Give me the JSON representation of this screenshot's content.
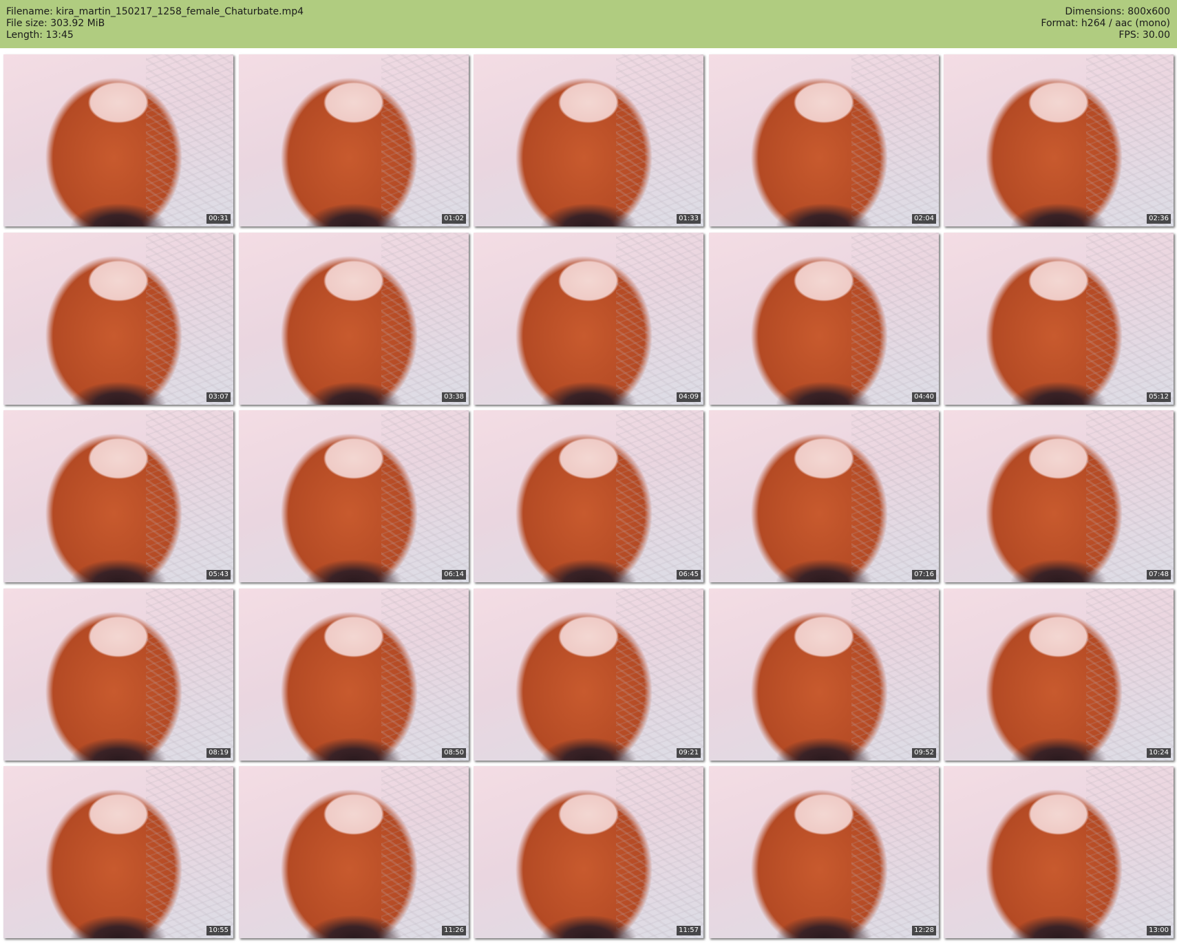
{
  "header": {
    "filename": "Filename: kira_martin_150217_1258_female_Chaturbate.mp4",
    "filesize": "File size: 303.92 MiB",
    "length": "Length: 13:45",
    "dimensions": "Dimensions: 800x600",
    "format": "Format: h264 / aac (mono)",
    "fps": "FPS: 30.00",
    "background_color": "#b0cc80"
  },
  "thumbnails": [
    {
      "timestamp": "00:31"
    },
    {
      "timestamp": "01:02"
    },
    {
      "timestamp": "01:33"
    },
    {
      "timestamp": "02:04"
    },
    {
      "timestamp": "02:36"
    },
    {
      "timestamp": "03:07"
    },
    {
      "timestamp": "03:38"
    },
    {
      "timestamp": "04:09"
    },
    {
      "timestamp": "04:40"
    },
    {
      "timestamp": "05:12"
    },
    {
      "timestamp": "05:43"
    },
    {
      "timestamp": "06:14"
    },
    {
      "timestamp": "06:45"
    },
    {
      "timestamp": "07:16"
    },
    {
      "timestamp": "07:48"
    },
    {
      "timestamp": "08:19"
    },
    {
      "timestamp": "08:50"
    },
    {
      "timestamp": "09:21"
    },
    {
      "timestamp": "09:52"
    },
    {
      "timestamp": "10:24"
    },
    {
      "timestamp": "10:55"
    },
    {
      "timestamp": "11:26"
    },
    {
      "timestamp": "11:57"
    },
    {
      "timestamp": "12:28"
    },
    {
      "timestamp": "13:00"
    }
  ]
}
